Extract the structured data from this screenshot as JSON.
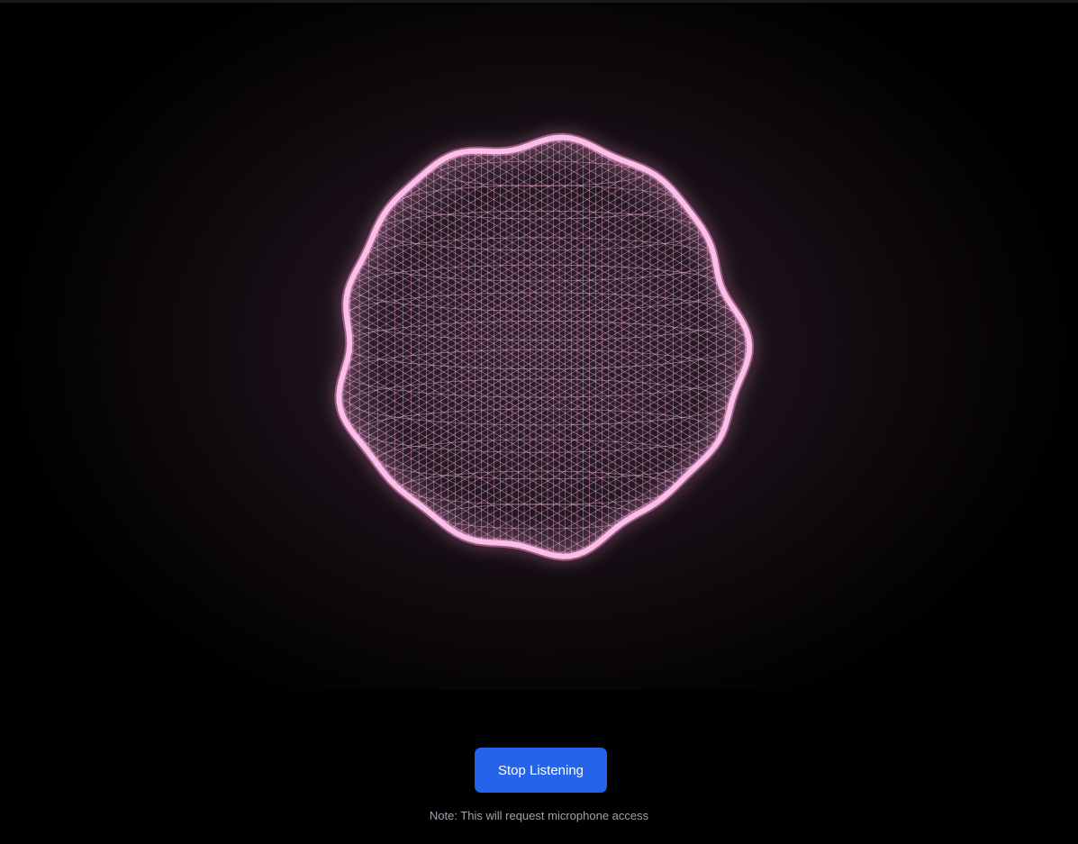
{
  "visualizer": {
    "shape": "wireframe-sphere",
    "color": "#ffb6e6",
    "glow_color": "#ff9ad8",
    "background_color": "#1f151d"
  },
  "controls": {
    "listen_button_label": "Stop Listening",
    "listen_button_color": "#2563eb",
    "note_text": "Note: This will request microphone access"
  }
}
